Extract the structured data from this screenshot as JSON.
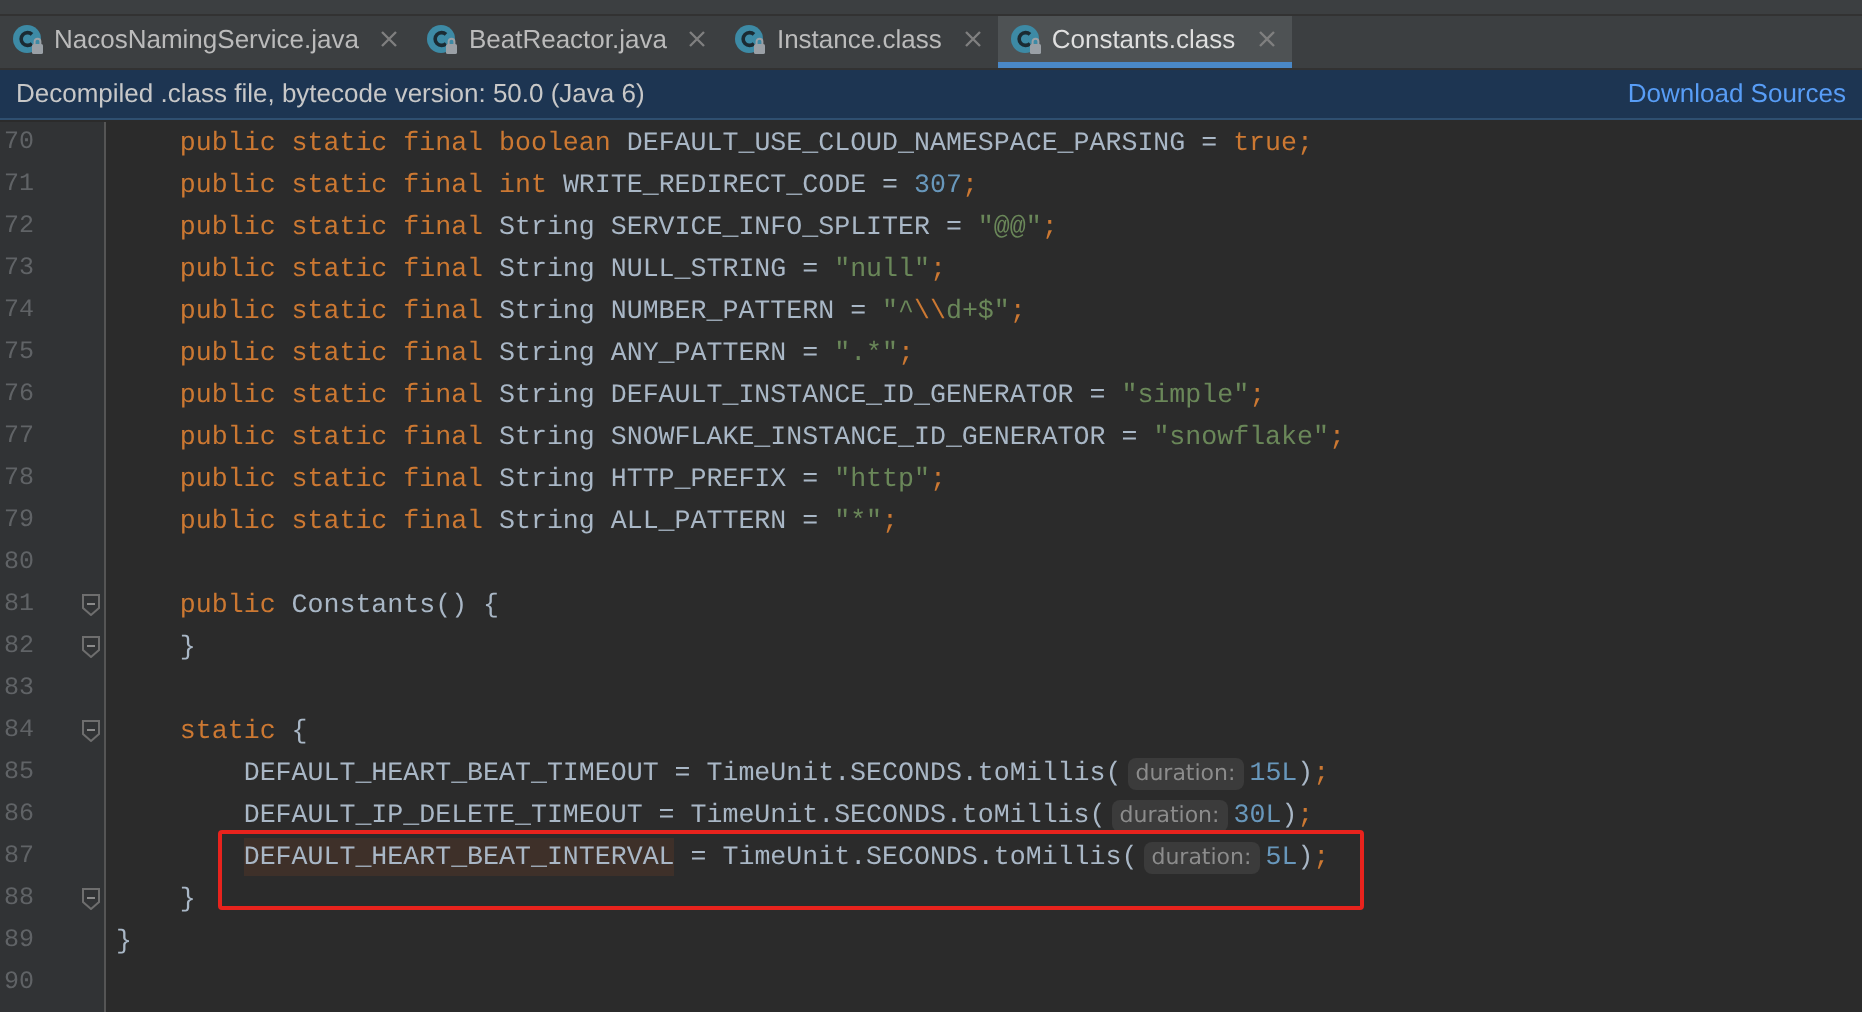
{
  "tabs": [
    {
      "label": "NacosNamingService.java",
      "selected": false
    },
    {
      "label": "BeatReactor.java",
      "selected": false
    },
    {
      "label": "Instance.class",
      "selected": false
    },
    {
      "label": "Constants.class",
      "selected": true
    }
  ],
  "banner": {
    "text": "Decompiled .class file, bytecode version: 50.0 (Java 6)",
    "link": "Download Sources"
  },
  "lines": [
    {
      "number": "70",
      "fold": false,
      "tokens": [
        {
          "kind": "kw",
          "text": "    public static final boolean "
        },
        {
          "kind": "plain",
          "text": "DEFAULT_USE_CLOUD_NAMESPACE_PARSING = "
        },
        {
          "kind": "kw",
          "text": "true"
        },
        {
          "kind": "semi",
          "text": ";"
        }
      ]
    },
    {
      "number": "71",
      "fold": false,
      "tokens": [
        {
          "kind": "kw",
          "text": "    public static final int "
        },
        {
          "kind": "plain",
          "text": "WRITE_REDIRECT_CODE = "
        },
        {
          "kind": "num",
          "text": "307"
        },
        {
          "kind": "semi",
          "text": ";"
        }
      ]
    },
    {
      "number": "72",
      "fold": false,
      "tokens": [
        {
          "kind": "kw",
          "text": "    public static final "
        },
        {
          "kind": "plain",
          "text": "String SERVICE_INFO_SPLITER = "
        },
        {
          "kind": "str",
          "text": "\"@@\""
        },
        {
          "kind": "semi",
          "text": ";"
        }
      ]
    },
    {
      "number": "73",
      "fold": false,
      "tokens": [
        {
          "kind": "kw",
          "text": "    public static final "
        },
        {
          "kind": "plain",
          "text": "String NULL_STRING = "
        },
        {
          "kind": "str",
          "text": "\"null\""
        },
        {
          "kind": "semi",
          "text": ";"
        }
      ]
    },
    {
      "number": "74",
      "fold": false,
      "tokens": [
        {
          "kind": "kw",
          "text": "    public static final "
        },
        {
          "kind": "plain",
          "text": "String NUMBER_PATTERN = "
        },
        {
          "kind": "str",
          "text": "\"^"
        },
        {
          "kind": "esc",
          "text": "\\\\"
        },
        {
          "kind": "str",
          "text": "d+$\""
        },
        {
          "kind": "semi",
          "text": ";"
        }
      ]
    },
    {
      "number": "75",
      "fold": false,
      "tokens": [
        {
          "kind": "kw",
          "text": "    public static final "
        },
        {
          "kind": "plain",
          "text": "String ANY_PATTERN = "
        },
        {
          "kind": "str",
          "text": "\".*\""
        },
        {
          "kind": "semi",
          "text": ";"
        }
      ]
    },
    {
      "number": "76",
      "fold": false,
      "tokens": [
        {
          "kind": "kw",
          "text": "    public static final "
        },
        {
          "kind": "plain",
          "text": "String DEFAULT_INSTANCE_ID_GENERATOR = "
        },
        {
          "kind": "str",
          "text": "\"simple\""
        },
        {
          "kind": "semi",
          "text": ";"
        }
      ]
    },
    {
      "number": "77",
      "fold": false,
      "tokens": [
        {
          "kind": "kw",
          "text": "    public static final "
        },
        {
          "kind": "plain",
          "text": "String SNOWFLAKE_INSTANCE_ID_GENERATOR = "
        },
        {
          "kind": "str",
          "text": "\"snowflake\""
        },
        {
          "kind": "semi",
          "text": ";"
        }
      ]
    },
    {
      "number": "78",
      "fold": false,
      "tokens": [
        {
          "kind": "kw",
          "text": "    public static final "
        },
        {
          "kind": "plain",
          "text": "String HTTP_PREFIX = "
        },
        {
          "kind": "str",
          "text": "\"http\""
        },
        {
          "kind": "semi",
          "text": ";"
        }
      ]
    },
    {
      "number": "79",
      "fold": false,
      "tokens": [
        {
          "kind": "kw",
          "text": "    public static final "
        },
        {
          "kind": "plain",
          "text": "String ALL_PATTERN = "
        },
        {
          "kind": "str",
          "text": "\"*\""
        },
        {
          "kind": "semi",
          "text": ";"
        }
      ]
    },
    {
      "number": "80",
      "fold": false
    },
    {
      "number": "81",
      "fold": true,
      "tokens": [
        {
          "kind": "kw",
          "text": "    public "
        },
        {
          "kind": "plain",
          "text": "Constants() {"
        }
      ]
    },
    {
      "number": "82",
      "fold": true,
      "tokens": [
        {
          "kind": "plain",
          "text": "    }"
        }
      ]
    },
    {
      "number": "83",
      "fold": false
    },
    {
      "number": "84",
      "fold": true,
      "tokens": [
        {
          "kind": "kw",
          "text": "    static "
        },
        {
          "kind": "plain",
          "text": "{"
        }
      ]
    },
    {
      "number": "85",
      "fold": false,
      "tokens": [
        {
          "kind": "plain",
          "text": "        DEFAULT_HEART_BEAT_TIMEOUT = TimeUnit.SECONDS.toMillis("
        },
        {
          "kind": "hint",
          "text": "duration:"
        },
        {
          "kind": "num",
          "text": "15L"
        },
        {
          "kind": "plain",
          "text": ")"
        },
        {
          "kind": "semi",
          "text": ";"
        }
      ]
    },
    {
      "number": "86",
      "fold": false,
      "tokens": [
        {
          "kind": "plain",
          "text": "        DEFAULT_IP_DELETE_TIMEOUT = TimeUnit.SECONDS.toMillis("
        },
        {
          "kind": "hint",
          "text": "duration:"
        },
        {
          "kind": "num",
          "text": "30L"
        },
        {
          "kind": "plain",
          "text": ")"
        },
        {
          "kind": "semi",
          "text": ";"
        }
      ]
    },
    {
      "number": "87",
      "fold": false,
      "boxed": true,
      "tokens": [
        {
          "kind": "mark",
          "text": "        DEFAULT_HEART_BEAT_INTERVAL"
        },
        {
          "kind": "plain",
          "text": " = TimeUnit.SECONDS.toMillis("
        },
        {
          "kind": "hint",
          "text": "duration:"
        },
        {
          "kind": "num",
          "text": "5L"
        },
        {
          "kind": "plain",
          "text": ")"
        },
        {
          "kind": "semi",
          "text": ";"
        }
      ]
    },
    {
      "number": "88",
      "fold": true,
      "tokens": [
        {
          "kind": "plain",
          "text": "    }"
        }
      ]
    },
    {
      "number": "89",
      "fold": false,
      "tokens": [
        {
          "kind": "plain",
          "text": "}"
        }
      ]
    },
    {
      "number": "90",
      "fold": false
    }
  ]
}
